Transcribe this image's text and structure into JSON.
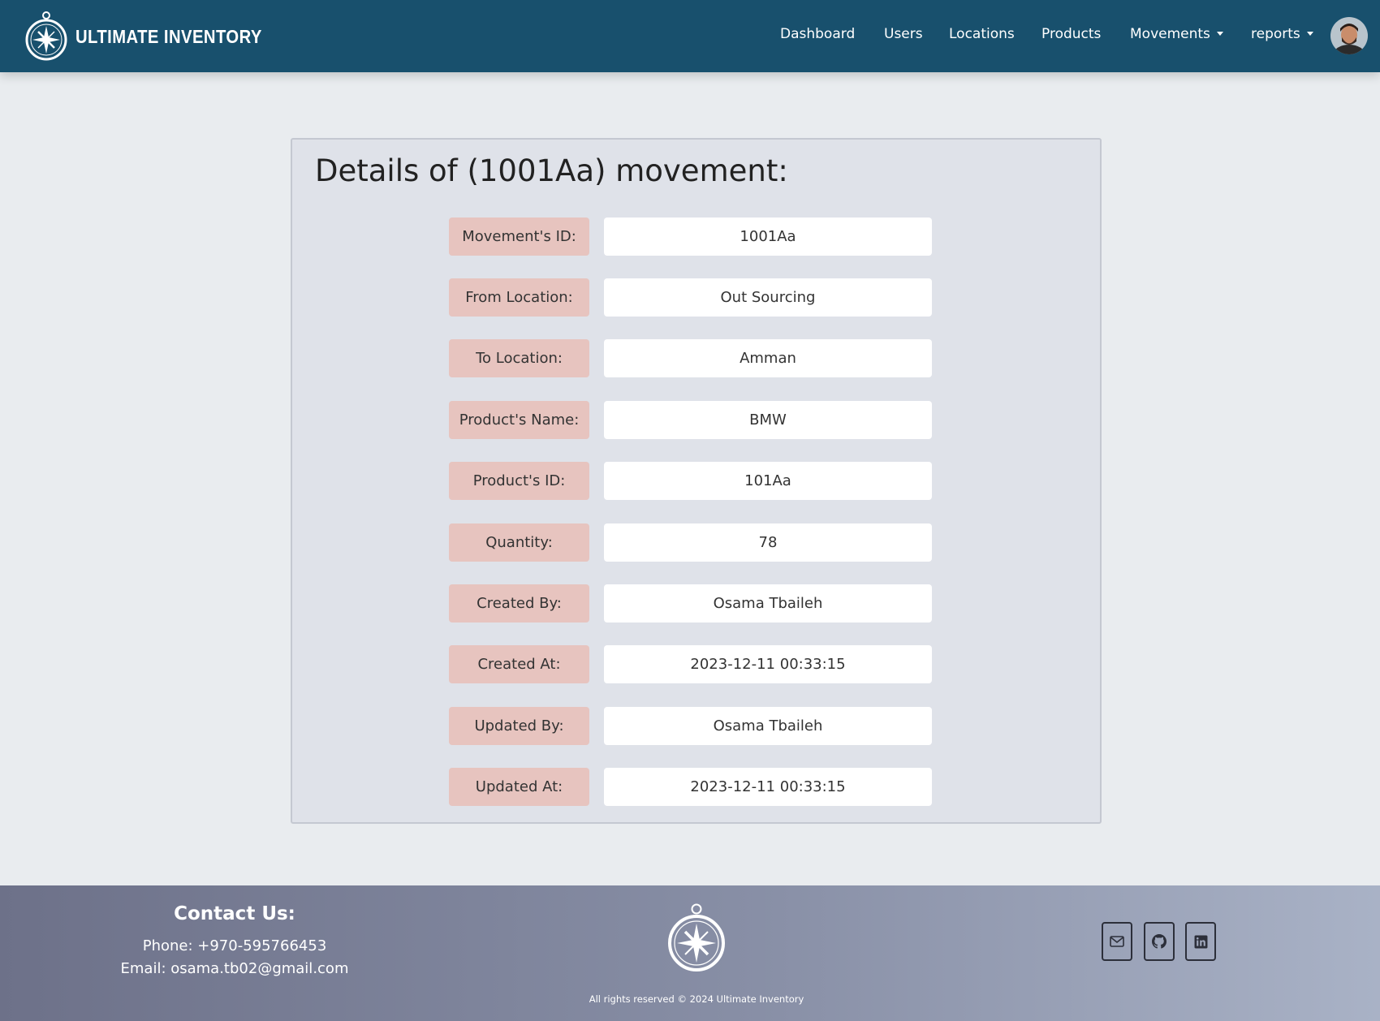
{
  "navbar": {
    "brand": "ULTIMATE INVENTORY",
    "links": [
      {
        "label": "Dashboard"
      },
      {
        "label": "Users"
      },
      {
        "label": "Locations"
      },
      {
        "label": "Products"
      },
      {
        "label": "Movements",
        "dropdown": true
      },
      {
        "label": "reports",
        "dropdown": true
      }
    ],
    "avatar_icon": "user-avatar"
  },
  "details": {
    "title": "Details of (1001Aa) movement:",
    "rows": [
      {
        "label": "Movement's ID:",
        "value": "1001Aa"
      },
      {
        "label": "From Location:",
        "value": "Out Sourcing"
      },
      {
        "label": "To Location:",
        "value": "Amman"
      },
      {
        "label": "Product's Name:",
        "value": "BMW"
      },
      {
        "label": "Product's ID:",
        "value": "101Aa"
      },
      {
        "label": "Quantity:",
        "value": "78"
      },
      {
        "label": "Created By:",
        "value": "Osama Tbaileh"
      },
      {
        "label": "Created At:",
        "value": "2023-12-11 00:33:15"
      },
      {
        "label": "Updated By:",
        "value": "Osama Tbaileh"
      },
      {
        "label": "Updated At:",
        "value": "2023-12-11 00:33:15"
      }
    ]
  },
  "footer": {
    "contact_title": "Contact Us:",
    "phone": "Phone: +970-595766453",
    "email": "Email: osama.tb02@gmail.com",
    "copyright": "All rights reserved © 2024 Ultimate Inventory",
    "social_icons": [
      "mail-icon",
      "github-icon",
      "linkedin-icon"
    ]
  },
  "colors": {
    "navbar": "#18506d",
    "label_bg": "#e7c4bf",
    "card_bg": "#dfe2e9",
    "page_bg": "#e9ecef"
  }
}
